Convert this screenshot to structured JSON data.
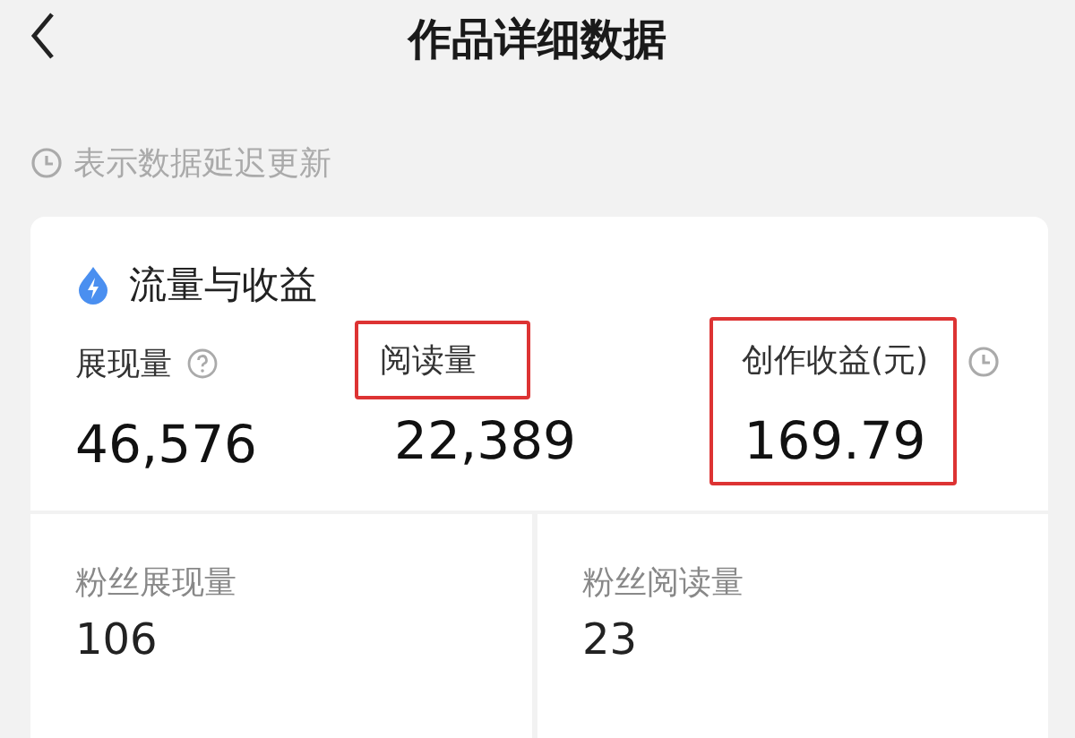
{
  "header": {
    "title": "作品详细数据"
  },
  "note": "表示数据延迟更新",
  "card": {
    "title": "流量与收益",
    "metrics": [
      {
        "kind": "info",
        "label": "展现量",
        "value": "46,576"
      },
      {
        "kind": "flagged",
        "label": "阅读量",
        "value": "22,389"
      },
      {
        "kind": "boxed",
        "label": "创作收益(元)",
        "value": "169.79"
      }
    ],
    "sub_metrics": [
      {
        "label": "粉丝展现量",
        "value": "106"
      },
      {
        "label": "粉丝阅读量",
        "value": "23"
      }
    ]
  }
}
